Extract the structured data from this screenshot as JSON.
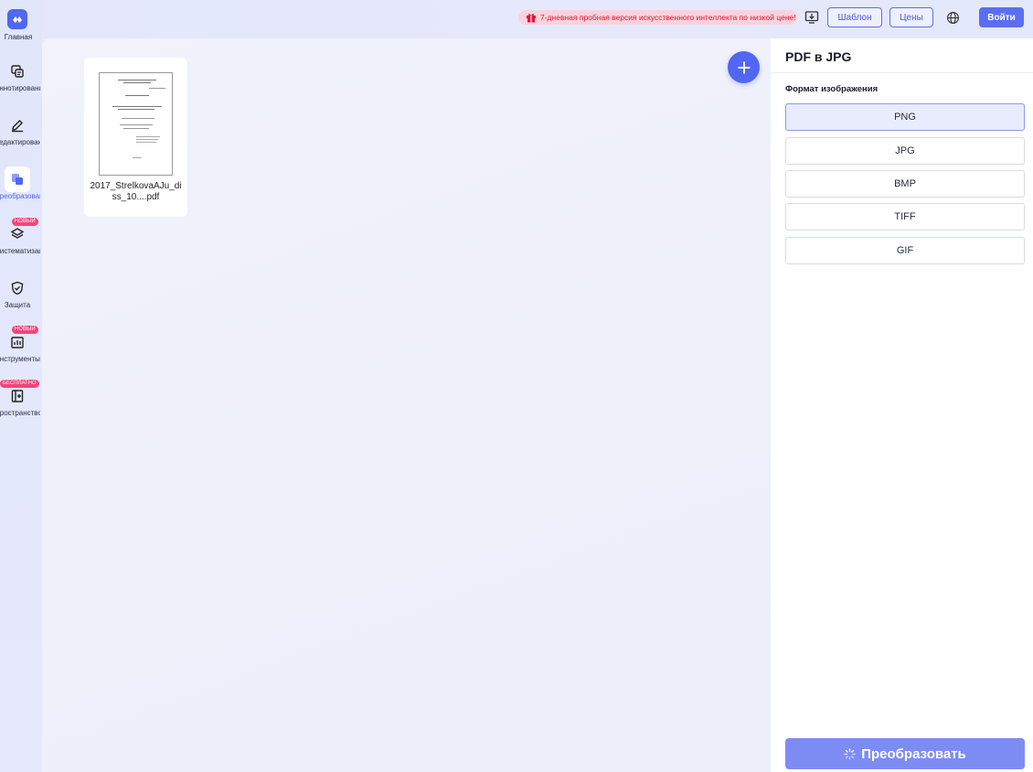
{
  "header": {
    "promo_text": "7-дневная пробная версия искусственного интеллекта по низкой цене!",
    "template_label": "Шаблон",
    "pricing_label": "Цены",
    "login_label": "Войти"
  },
  "sidebar": {
    "logo_label": "Главная",
    "items": [
      {
        "label": "Аннотирование",
        "icon": "annotate-icon",
        "badge": ""
      },
      {
        "label": "Редактирование",
        "icon": "edit-icon",
        "badge": ""
      },
      {
        "label": "Преобразование",
        "icon": "convert-icon",
        "badge": "",
        "active": true
      },
      {
        "label": "Систематизация",
        "icon": "layers-icon",
        "badge": "НОВЫЙ"
      },
      {
        "label": "Защита",
        "icon": "shield-icon",
        "badge": ""
      },
      {
        "label": "Инструменты",
        "icon": "tools-icon",
        "badge": "НОВЫЙ"
      },
      {
        "label": "Пространство",
        "icon": "space-icon",
        "badge": "БЕСПЛАТНО"
      }
    ]
  },
  "files": [
    {
      "name": "2017_StrelkovaAJu_diss_10....pdf"
    }
  ],
  "panel": {
    "title": "PDF в JPG",
    "format_label": "Формат изображения",
    "formats": [
      "PNG",
      "JPG",
      "BMP",
      "TIFF",
      "GIF"
    ],
    "selected_format": "PNG",
    "convert_label": "Преобразовать"
  },
  "colors": {
    "accent": "#5166f2",
    "promo_text": "#e0143c",
    "badge": "#f2457a"
  }
}
